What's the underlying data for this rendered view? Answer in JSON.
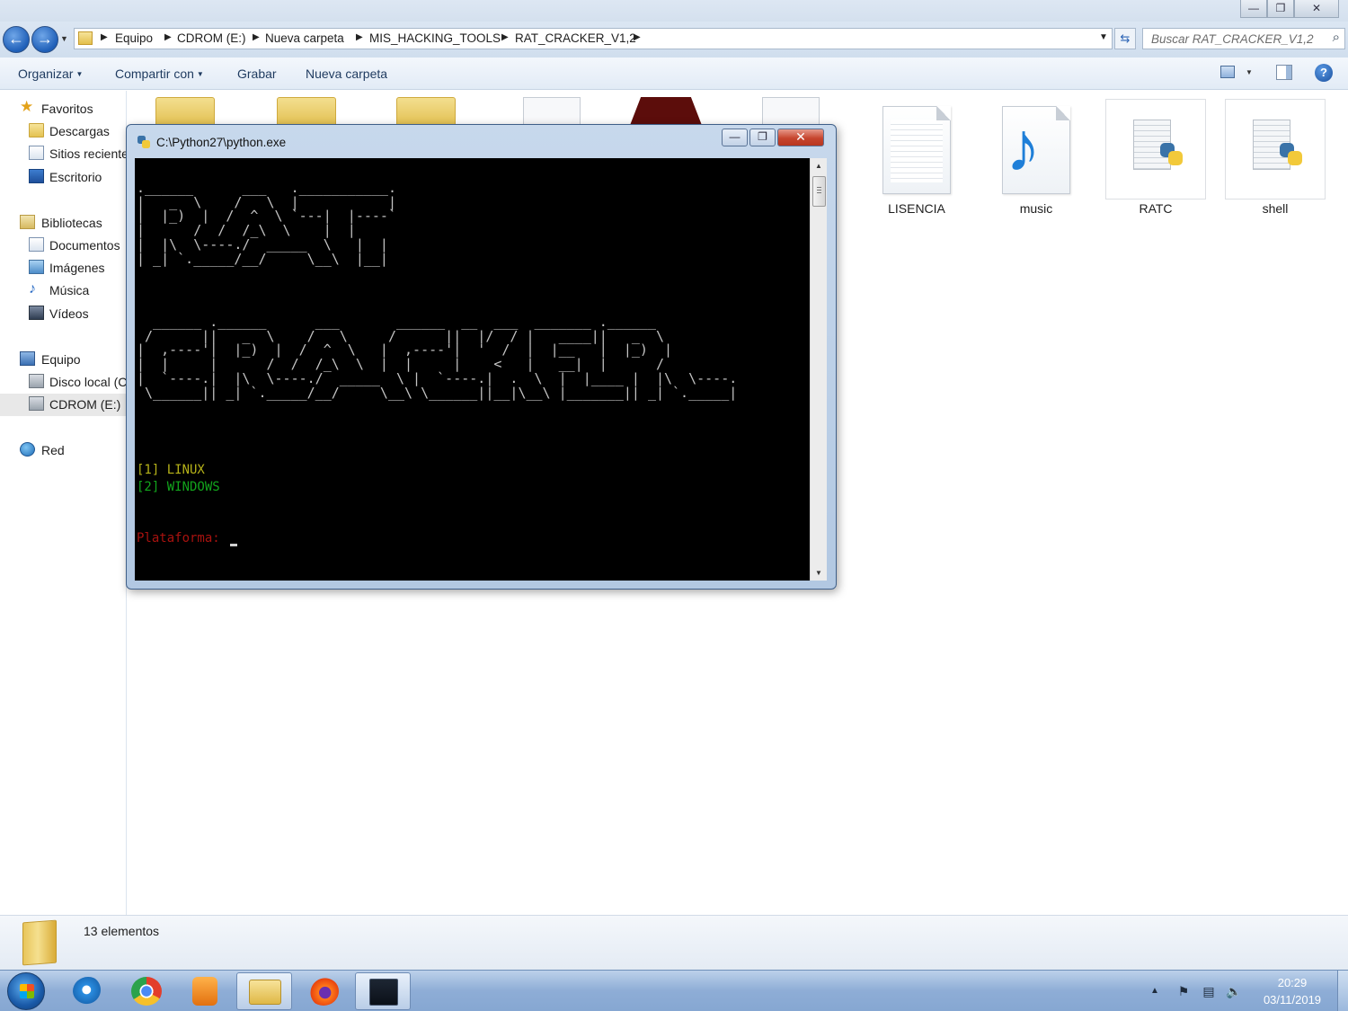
{
  "explorer": {
    "address_crumbs": [
      "Equipo",
      "CDROM (E:)",
      "Nueva carpeta",
      "MIS_HACKING_TOOLS",
      "RAT_CRACKER_V1,2"
    ],
    "search_placeholder": "Buscar RAT_CRACKER_V1,2",
    "toolbar": {
      "organize": "Organizar",
      "share": "Compartir con",
      "burn": "Grabar",
      "new_folder": "Nueva carpeta"
    },
    "nav": {
      "favorites": "Favoritos",
      "downloads": "Descargas",
      "recent": "Sitios recientes",
      "desktop": "Escritorio",
      "libraries": "Bibliotecas",
      "documents": "Documentos",
      "images": "Imágenes",
      "music": "Música",
      "videos": "Vídeos",
      "computer": "Equipo",
      "local_disk": "Disco local (C:)",
      "cdrom": "CDROM (E:)",
      "network": "Red"
    },
    "files": [
      {
        "name": "LISENCIA",
        "icon": "text-file-icon"
      },
      {
        "name": "music",
        "icon": "audio-file-icon"
      },
      {
        "name": "RATC",
        "icon": "python-file-icon"
      },
      {
        "name": "shell",
        "icon": "python-file-icon"
      }
    ],
    "status": "13 elementos"
  },
  "console": {
    "title": "C:\\Python27\\python.exe",
    "ascii_rat": ".______      ___   .___________.\n|   _  \\    /   \\  |           |\n|  |_)  |  /  ^  \\ `---|  |----`\n|      /  /  /_\\  \\    |  |\n|  |\\  \\----./  _____  \\   |  |\n| _| `._____/__/     \\__\\  |__|",
    "ascii_cracker": "  ______ .______      ___       ______  __  ___  _______ .______\n /      ||   _  \\    /   \\     /      ||  |/  / |   ____||   _  \\\n|  ,----'|  |_)  |  /  ^  \\   |  ,----'|  '  /  |  |__   |  |_)  |\n|  |     |      /  /  /_\\  \\  |  |     |    <   |   __|  |      /\n|  `----.|  |\\  \\----./  _____  \\ |  `----.|  .  \\  |  |____ |  |\\  \\----.\n \\______|| _| `._____/__/     \\__\\ \\______||__|\\__\\ |_______|| _| `._____|",
    "option_linux": "[1] LINUX",
    "option_windows": "[2] WINDOWS",
    "prompt": "Plataforma:"
  },
  "taskbar": {
    "time": "20:29",
    "date": "03/11/2019",
    "apps": [
      "internet-explorer",
      "chrome",
      "media-player",
      "windows-explorer",
      "firefox",
      "python-console"
    ]
  },
  "colors": {
    "linux_option": "#b6b219",
    "windows_option": "#12a51c",
    "prompt": "#a8120f",
    "console_bg": "#000000",
    "ascii_art": "#c4c4c4"
  }
}
